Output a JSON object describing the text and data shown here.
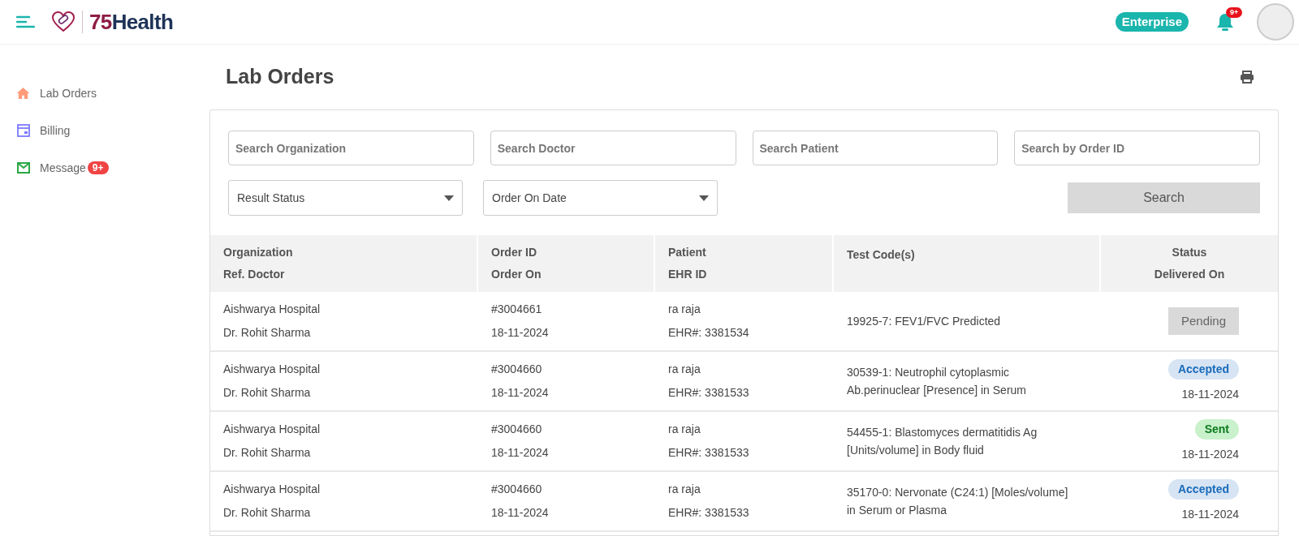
{
  "header": {
    "brand_number": "75",
    "brand_name": "Health",
    "plan_badge": "Enterprise",
    "notification_count": "9+"
  },
  "sidebar": {
    "items": [
      {
        "label": "Lab Orders",
        "kind": "home"
      },
      {
        "label": "Billing",
        "kind": "billing"
      },
      {
        "label": "Message",
        "kind": "mail",
        "badge": "9+"
      }
    ]
  },
  "page": {
    "title": "Lab Orders"
  },
  "filters": {
    "search_fields": [
      {
        "placeholder": "Search Organization"
      },
      {
        "placeholder": "Search Doctor"
      },
      {
        "placeholder": "Search Patient"
      },
      {
        "placeholder": "Search by Order ID"
      }
    ],
    "dropdowns": [
      {
        "value": "Result Status"
      },
      {
        "value": "Order On Date"
      }
    ],
    "search_button": "Search"
  },
  "table": {
    "columns": [
      {
        "line1": "Organization",
        "line2": "Ref. Doctor"
      },
      {
        "line1": "Order ID",
        "line2": "Order On"
      },
      {
        "line1": "Patient",
        "line2": "EHR ID"
      },
      {
        "line1": "Test Code(s)"
      },
      {
        "line1": "Status",
        "line2": "Delivered On"
      }
    ],
    "rows": [
      {
        "organization": "Aishwarya Hospital",
        "doctor": "Dr. Rohit Sharma",
        "order_id": "#3004661",
        "order_on": "18-11-2024",
        "patient": "ra raja",
        "ehr_id": "EHR#: 3381534",
        "test_code": "19925-7: FEV1/FVC Predicted",
        "status": {
          "kind": "pending",
          "label": "Pending"
        }
      },
      {
        "organization": "Aishwarya Hospital",
        "doctor": "Dr. Rohit Sharma",
        "order_id": "#3004660",
        "order_on": "18-11-2024",
        "patient": "ra raja",
        "ehr_id": "EHR#: 3381533",
        "test_code": "30539-1: Neutrophil cytoplasmic Ab.perinuclear [Presence] in Serum",
        "status": {
          "kind": "accepted",
          "label": "Accepted"
        },
        "delivered_on": "18-11-2024"
      },
      {
        "organization": "Aishwarya Hospital",
        "doctor": "Dr. Rohit Sharma",
        "order_id": "#3004660",
        "order_on": "18-11-2024",
        "patient": "ra raja",
        "ehr_id": "EHR#: 3381533",
        "test_code": "54455-1: Blastomyces dermatitidis Ag [Units/volume] in Body fluid",
        "status": {
          "kind": "sent",
          "label": "Sent"
        },
        "delivered_on": "18-11-2024"
      },
      {
        "organization": "Aishwarya Hospital",
        "doctor": "Dr. Rohit Sharma",
        "order_id": "#3004660",
        "order_on": "18-11-2024",
        "patient": "ra raja",
        "ehr_id": "EHR#: 3381533",
        "test_code": "35170-0: Nervonate (C24:1) [Moles/volume] in Serum or Plasma",
        "status": {
          "kind": "accepted",
          "label": "Accepted"
        },
        "delivered_on": "18-11-2024"
      }
    ]
  }
}
